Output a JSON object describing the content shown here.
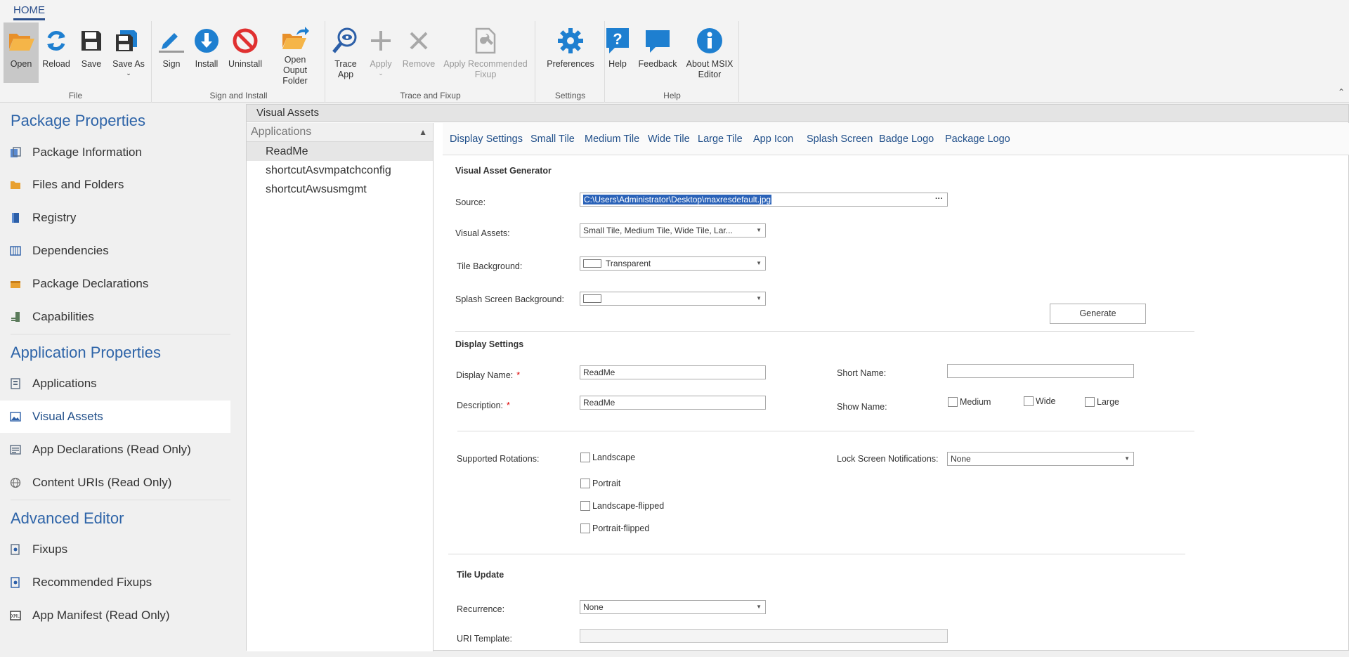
{
  "ribbon": {
    "tab": "HOME",
    "groups": {
      "file": "File",
      "sign_install": "Sign and Install",
      "trace_fixup": "Trace and Fixup",
      "settings": "Settings",
      "help": "Help"
    },
    "buttons": {
      "open": "Open",
      "reload": "Reload",
      "save": "Save",
      "save_as": "Save As",
      "sign": "Sign",
      "install": "Install",
      "uninstall": "Uninstall",
      "open_output": "Open Ouput Folder",
      "trace_app": "Trace App",
      "apply": "Apply",
      "remove": "Remove",
      "apply_recommended": "Apply Recommended Fixup",
      "preferences": "Preferences",
      "help": "Help",
      "feedback": "Feedback",
      "about": "About MSIX Editor"
    }
  },
  "sidebar": {
    "package_title": "Package Properties",
    "package_items": [
      "Package Information",
      "Files and Folders",
      "Registry",
      "Dependencies",
      "Package Declarations",
      "Capabilities"
    ],
    "application_title": "Application Properties",
    "application_items": [
      "Applications",
      "Visual Assets",
      "App Declarations (Read Only)",
      "Content URIs (Read Only)"
    ],
    "advanced_title": "Advanced Editor",
    "advanced_items": [
      "Fixups",
      "Recommended Fixups",
      "App Manifest (Read Only)"
    ],
    "active": "Visual Assets"
  },
  "content": {
    "header": "Visual Assets",
    "apps_header": "Applications",
    "apps": [
      "ReadMe",
      "shortcutAsvmpatchconfig",
      "shortcutAwsusmgmt"
    ],
    "selected_app": "ReadMe",
    "tabs": [
      "Display Settings",
      "Small Tile",
      "Medium Tile",
      "Wide Tile",
      "Large Tile",
      "App Icon",
      "Splash Screen",
      "Badge Logo",
      "Package Logo"
    ],
    "active_tab": "Display Settings"
  },
  "generator": {
    "title": "Visual Asset Generator",
    "source_label": "Source:",
    "source_value": "C:\\Users\\Administrator\\Desktop\\maxresdefault.jpg",
    "assets_label": "Visual Assets:",
    "assets_value": "Small Tile, Medium Tile, Wide Tile, Lar...",
    "tile_bg_label": "Tile Background:",
    "tile_bg_value": "Transparent",
    "splash_bg_label": "Splash Screen Background:",
    "splash_bg_value": "",
    "generate_button": "Generate"
  },
  "display": {
    "title": "Display Settings",
    "display_name_label": "Display Name:",
    "display_name_value": "ReadMe",
    "description_label": "Description:",
    "description_value": "ReadMe",
    "required_mark": "*",
    "short_name_label": "Short Name:",
    "short_name_value": "",
    "show_name_label": "Show Name:",
    "show_name_options": [
      "Medium",
      "Wide",
      "Large"
    ],
    "rotations_label": "Supported Rotations:",
    "rotations": [
      "Landscape",
      "Portrait",
      "Landscape-flipped",
      "Portrait-flipped"
    ],
    "lock_label": "Lock Screen Notifications:",
    "lock_value": "None"
  },
  "tile_update": {
    "title": "Tile Update",
    "recurrence_label": "Recurrence:",
    "recurrence_value": "None",
    "uri_label": "URI Template:",
    "uri_value": ""
  },
  "colors": {
    "accent": "#2e64a8",
    "open_icon": "#f0a030",
    "blue_icon": "#1e7fd0",
    "red_icon": "#e03030"
  }
}
